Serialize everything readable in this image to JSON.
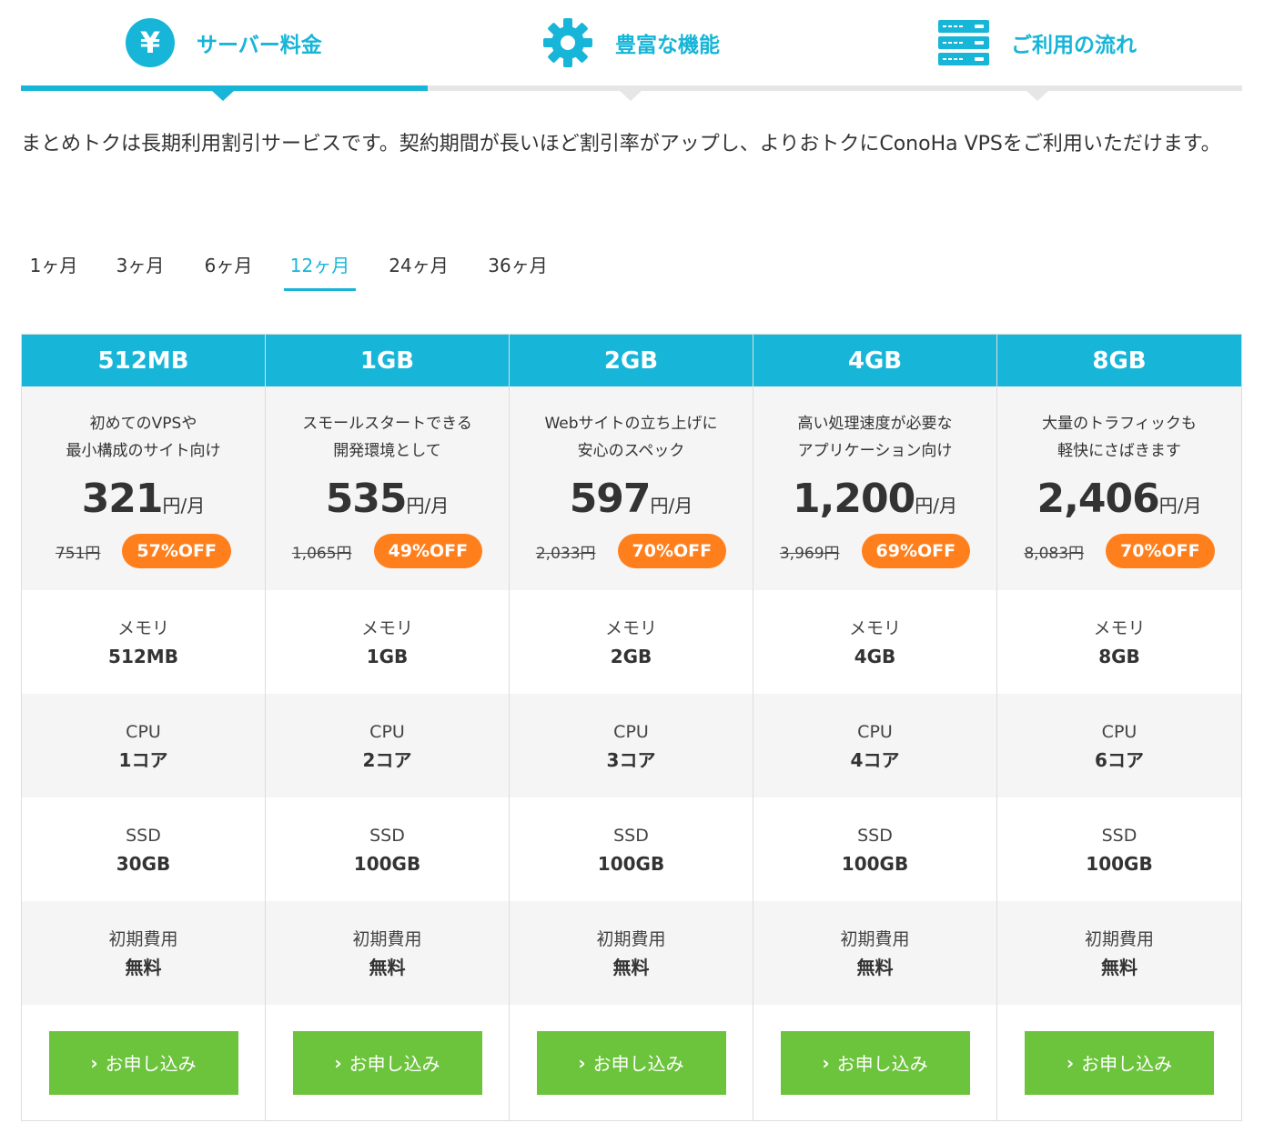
{
  "tabs": [
    {
      "label": "サーバー料金",
      "icon": "yen-icon",
      "active": true
    },
    {
      "label": "豊富な機能",
      "icon": "gear-icon",
      "active": false
    },
    {
      "label": "ご利用の流れ",
      "icon": "server-icon",
      "active": false
    }
  ],
  "yen_symbol": "¥",
  "description": "まとめトクは長期利用割引サービスです。契約期間が長いほど割引率がアップし、よりおトクにConoHa VPSをご利用いただけます。",
  "periods": [
    "1ヶ月",
    "3ヶ月",
    "6ヶ月",
    "12ヶ月",
    "24ヶ月",
    "36ヶ月"
  ],
  "active_period": "12ヶ月",
  "colors": {
    "accent": "#17b5d8",
    "offer": "#ff7f1d",
    "button": "#6cc33c",
    "panel": "#f5f5f5"
  },
  "spec_labels": {
    "memory": "メモリ",
    "cpu": "CPU",
    "ssd": "SSD",
    "initial": "初期費用"
  },
  "price_unit": "円/月",
  "apply_label": "お申し込み",
  "plans": [
    {
      "name": "512MB",
      "catch1": "初めてのVPSや",
      "catch2": "最小構成のサイト向け",
      "price": "321",
      "original": "751円",
      "off": "57%OFF",
      "memory": "512MB",
      "cpu": "1コア",
      "ssd": "30GB",
      "initial": "無料"
    },
    {
      "name": "1GB",
      "catch1": "スモールスタートできる",
      "catch2": "開発環境として",
      "price": "535",
      "original": "1,065円",
      "off": "49%OFF",
      "memory": "1GB",
      "cpu": "2コア",
      "ssd": "100GB",
      "initial": "無料"
    },
    {
      "name": "2GB",
      "catch1": "Webサイトの立ち上げに",
      "catch2": "安心のスペック",
      "price": "597",
      "original": "2,033円",
      "off": "70%OFF",
      "memory": "2GB",
      "cpu": "3コア",
      "ssd": "100GB",
      "initial": "無料"
    },
    {
      "name": "4GB",
      "catch1": "高い処理速度が必要な",
      "catch2": "アプリケーション向け",
      "price": "1,200",
      "original": "3,969円",
      "off": "69%OFF",
      "memory": "4GB",
      "cpu": "4コア",
      "ssd": "100GB",
      "initial": "無料"
    },
    {
      "name": "8GB",
      "catch1": "大量のトラフィックも",
      "catch2": "軽快にさばきます",
      "price": "2,406",
      "original": "8,083円",
      "off": "70%OFF",
      "memory": "8GB",
      "cpu": "6コア",
      "ssd": "100GB",
      "initial": "無料"
    }
  ]
}
